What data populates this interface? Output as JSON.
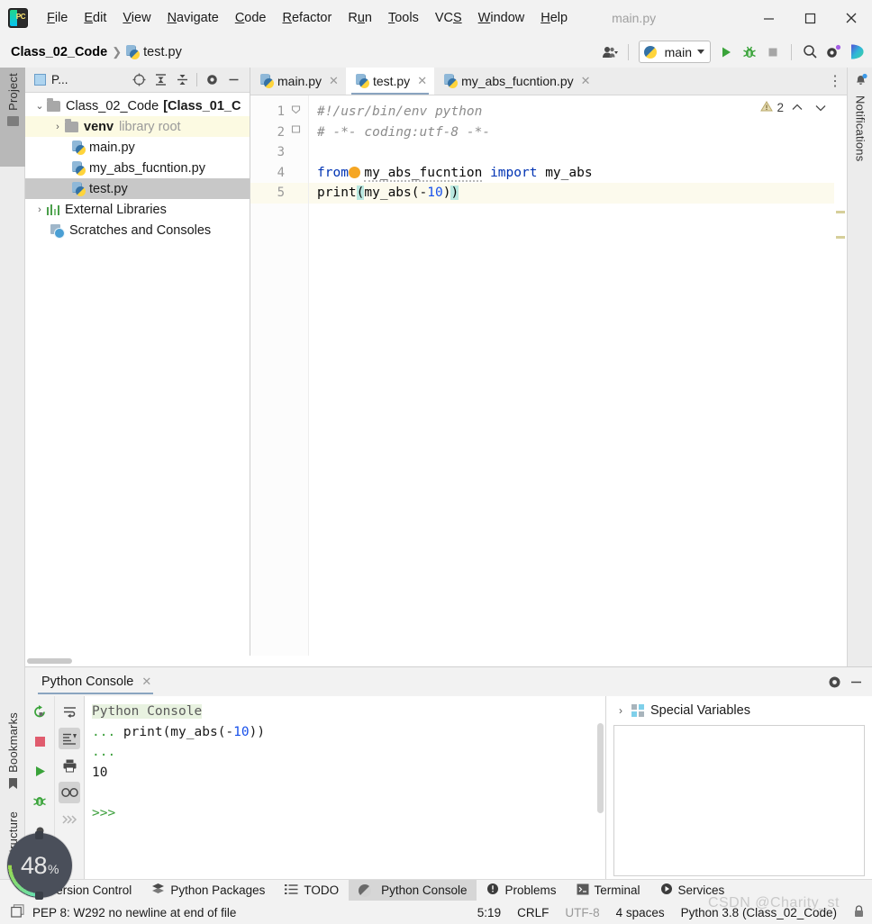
{
  "window": {
    "app_icon": "pycharm-logo-icon",
    "document_title": "main.py",
    "minimize": "─",
    "maximize": "☐",
    "close": "✕"
  },
  "menubar": {
    "items": [
      {
        "label": "File",
        "mnemonic": "F"
      },
      {
        "label": "Edit",
        "mnemonic": "E"
      },
      {
        "label": "View",
        "mnemonic": "V"
      },
      {
        "label": "Navigate",
        "mnemonic": "N"
      },
      {
        "label": "Code",
        "mnemonic": "C"
      },
      {
        "label": "Refactor",
        "mnemonic": "R"
      },
      {
        "label": "Run",
        "mnemonic": "u"
      },
      {
        "label": "Tools",
        "mnemonic": "T"
      },
      {
        "label": "VCS",
        "mnemonic": "S"
      },
      {
        "label": "Window",
        "mnemonic": "W"
      },
      {
        "label": "Help",
        "mnemonic": "H"
      }
    ]
  },
  "navbar": {
    "breadcrumb_root": "Class_02_Code",
    "breadcrumb_separator": "❯",
    "breadcrumb_file": "test.py",
    "run_config": "main",
    "icons": [
      "user-avatar-icon",
      "run-icon",
      "debug-icon",
      "stop-icon",
      "search-everywhere-icon",
      "settings-icon",
      "ai-assistant-icon"
    ]
  },
  "left_rail": {
    "project_tab": "Project",
    "bookmarks_tab": "Bookmarks",
    "structure_tab": "Structure"
  },
  "right_rail": {
    "notifications_tab": "Notifications"
  },
  "project_panel": {
    "title": "P...",
    "toolbar_icons": [
      "select-opened-file-icon",
      "expand-all-icon",
      "collapse-all-icon",
      "settings-icon",
      "hide-icon"
    ],
    "tree": [
      {
        "label": "Class_02_Code",
        "suffix": "[Class_01_C",
        "indent": 0,
        "arrow": "⌄",
        "icon": "folder-icon",
        "state": "normal"
      },
      {
        "label": "venv",
        "suffix": "library root",
        "indent": 1,
        "arrow": "›",
        "icon": "folder-icon",
        "state": "venv-highlight"
      },
      {
        "label": "main.py",
        "suffix": "",
        "indent": 2,
        "arrow": "",
        "icon": "python-file-icon",
        "state": "normal"
      },
      {
        "label": "my_abs_fucntion.py",
        "suffix": "",
        "indent": 2,
        "arrow": "",
        "icon": "python-file-icon",
        "state": "normal"
      },
      {
        "label": "test.py",
        "suffix": "",
        "indent": 2,
        "arrow": "",
        "icon": "python-file-icon",
        "state": "selected"
      },
      {
        "label": "External Libraries",
        "suffix": "",
        "indent": 0,
        "arrow": "›",
        "icon": "libraries-icon",
        "state": "normal"
      },
      {
        "label": "Scratches and Consoles",
        "suffix": "",
        "indent": 1,
        "arrow": "",
        "icon": "scratches-icon",
        "state": "normal"
      }
    ]
  },
  "editor": {
    "tabs": [
      {
        "label": "main.py",
        "active": false
      },
      {
        "label": "test.py",
        "active": true
      },
      {
        "label": "my_abs_fucntion.py",
        "active": false
      }
    ],
    "tab_close": "✕",
    "more_tabs": "⋮",
    "inspection_count": "2",
    "inspection_icon": "warning-triangle-icon",
    "prev_icon": "⌃",
    "next_icon": "⌄",
    "line_numbers": [
      "1",
      "2",
      "3",
      "4",
      "5"
    ],
    "lines": [
      {
        "n": "1",
        "text": "#!/usr/bin/env python",
        "kind": "comment"
      },
      {
        "n": "2",
        "text": "# -*- coding:utf-8 -*-",
        "kind": "comment"
      },
      {
        "n": "3",
        "text": "",
        "kind": "blank"
      },
      {
        "n": "4",
        "text": "from  my_abs_fucntion import my_abs",
        "kind": "import"
      },
      {
        "n": "5",
        "text": "print(my_abs(-10))",
        "kind": "call"
      }
    ],
    "l4_kw_from": "from",
    "l4_module": "my_abs_fucntion",
    "l4_kw_import": "import",
    "l4_name": "my_abs",
    "l5_fn": "print",
    "l5_open": "(",
    "l5_inner": "my_abs(-",
    "l5_num": "10",
    "l5_close1": ")",
    "l5_close2": ")"
  },
  "console": {
    "tab_label": "Python Console",
    "tab_close": "✕",
    "head_icons": [
      "settings-icon",
      "hide-icon"
    ],
    "toolbar_left": [
      "rerun-icon",
      "stop-icon",
      "execute-icon",
      "debug-icon",
      "attach-icon"
    ],
    "toolbar_right": [
      "soft-wrap-icon",
      "scroll-to-end-icon",
      "print-icon",
      "show-variables-icon",
      "next-prompt-icon"
    ],
    "output": [
      {
        "text": "Python Console",
        "kind": "title"
      },
      {
        "text": "... print(my_abs(-10))",
        "kind": "input"
      },
      {
        "text": "...",
        "kind": "dots"
      },
      {
        "text": "10",
        "kind": "result"
      },
      {
        "text": "",
        "kind": "blank"
      },
      {
        "text": ">>>",
        "kind": "prompt"
      }
    ],
    "input_prefix": "...",
    "input_code": " print(my_abs(-",
    "input_num": "10",
    "input_suffix": "))",
    "result_value": "10",
    "prompt": ">>>",
    "special_variables": {
      "label": "Special Variables",
      "arrow": "›",
      "icon": "special-variables-icon"
    }
  },
  "toolwindow_bar": {
    "items": [
      {
        "label": "Version Control",
        "icon": "version-control-icon",
        "active": false
      },
      {
        "label": "Python Packages",
        "icon": "packages-icon",
        "active": false
      },
      {
        "label": "TODO",
        "icon": "todo-icon",
        "active": false
      },
      {
        "label": "Python Console",
        "icon": "python-console-icon",
        "active": true
      },
      {
        "label": "Problems",
        "icon": "problems-icon",
        "active": false
      },
      {
        "label": "Terminal",
        "icon": "terminal-icon",
        "active": false
      },
      {
        "label": "Services",
        "icon": "services-icon",
        "active": false
      }
    ]
  },
  "statusbar": {
    "message_icon": "window-icon",
    "message": "PEP 8: W292 no newline at end of file",
    "caret_position": "5:19",
    "line_separator": "CRLF",
    "encoding": "UTF-8",
    "indent": "4 spaces",
    "interpreter": "Python 3.8 (Class_02_Code)",
    "lock_icon": "lock-icon"
  },
  "overlay": {
    "memory_percent": "48",
    "percent_sign": "%"
  },
  "watermark": "CSDN @Charity_st"
}
